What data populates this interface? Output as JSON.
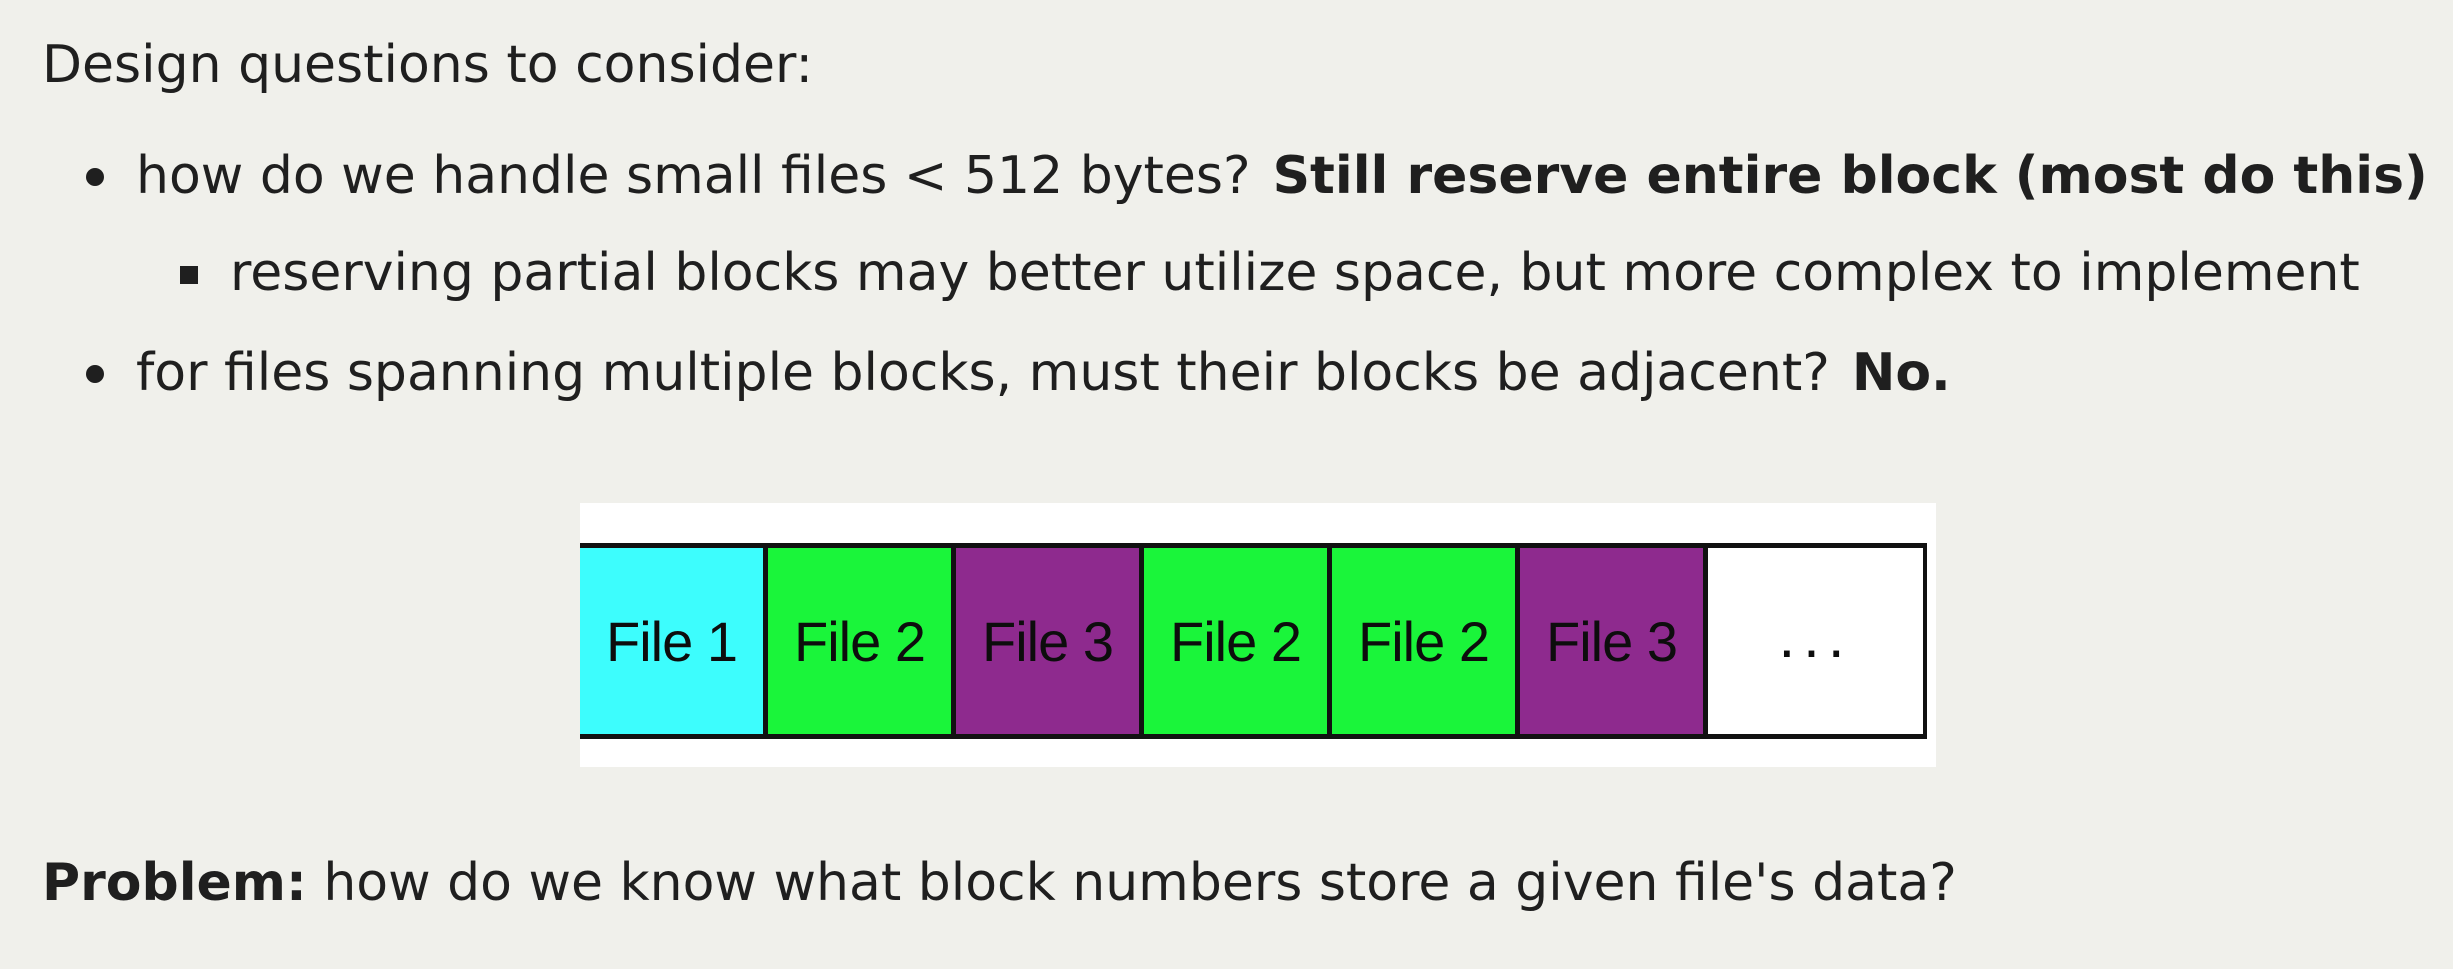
{
  "heading": "Design questions to consider:",
  "bullets": [
    {
      "text": "how do we handle small files < 512 bytes?",
      "answer": "Still reserve entire block (most do this)"
    },
    {
      "text": "reserving partial blocks may better utilize space, but more complex to implement"
    },
    {
      "text": "for files spanning multiple blocks, must their blocks be adjacent?",
      "answer": "No."
    }
  ],
  "diagram": {
    "blocks": [
      {
        "label": "File 1",
        "color": "#3dfdfd"
      },
      {
        "label": "File 2",
        "color": "#1af53a"
      },
      {
        "label": "File 3",
        "color": "#8e2a8e"
      },
      {
        "label": "File 2",
        "color": "#1af53a"
      },
      {
        "label": "File 2",
        "color": "#1af53a"
      },
      {
        "label": "File 3",
        "color": "#8e2a8e"
      },
      {
        "label": "...",
        "color": "#ffffff"
      }
    ]
  },
  "problem": {
    "label": "Problem:",
    "text": "how do we know what block numbers store a given file's data?"
  }
}
